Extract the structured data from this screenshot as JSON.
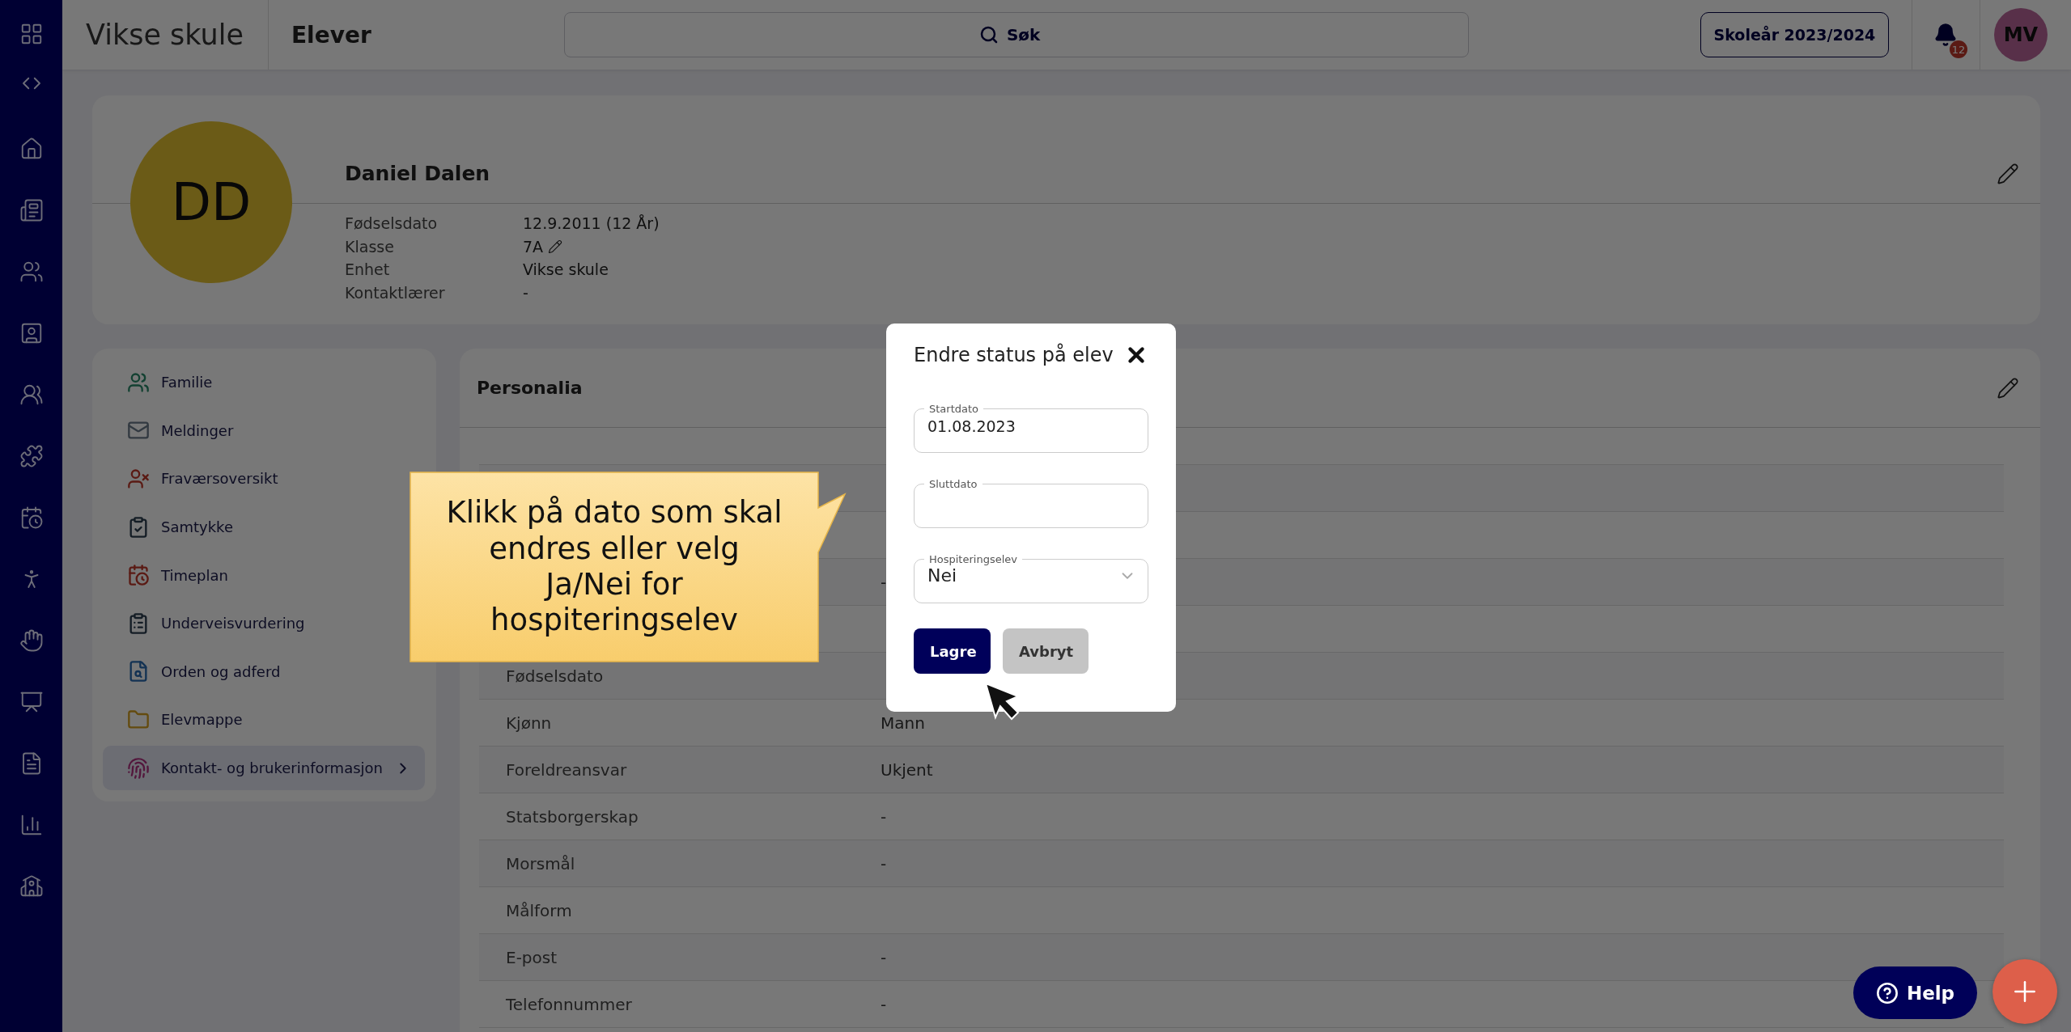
{
  "app_bar": {
    "school": "Vikse skule",
    "section": "Elever",
    "search": {
      "placeholder": "Søk"
    },
    "school_year": "Skoleår 2023/2024",
    "notification_count": "12",
    "user_initials": "MV"
  },
  "profile": {
    "initials": "DD",
    "name": "Daniel Dalen",
    "details": [
      {
        "label": "Fødselsdato",
        "value": "12.9.2011 (12 År)",
        "editable": false
      },
      {
        "label": "Klasse",
        "value": "7A",
        "editable": true
      },
      {
        "label": "Enhet",
        "value": "Vikse skule",
        "editable": false
      },
      {
        "label": "Kontaktlærer",
        "value": "-",
        "editable": false
      }
    ]
  },
  "side_menu": [
    {
      "label": "Familie",
      "selected": false
    },
    {
      "label": "Meldinger",
      "selected": false
    },
    {
      "label": "Fraværsoversikt",
      "selected": false
    },
    {
      "label": "Samtykke",
      "selected": false
    },
    {
      "label": "Timeplan",
      "selected": false
    },
    {
      "label": "Underveisvurdering",
      "selected": false
    },
    {
      "label": "Orden og adferd",
      "selected": false
    },
    {
      "label": "Elevmappe",
      "selected": false
    },
    {
      "label": "Kontakt- og brukerinformasjon",
      "selected": true
    }
  ],
  "personalia": {
    "title": "Personalia",
    "rows": [
      {},
      {},
      {
        "value": "-"
      },
      {},
      {
        "label": "Fødselsdato"
      },
      {
        "label": "Kjønn",
        "value": "Mann"
      },
      {
        "label": "Foreldreansvar",
        "value": "Ukjent"
      },
      {
        "label": "Statsborgerskap",
        "value": "-"
      },
      {
        "label": "Morsmål",
        "value": "-"
      },
      {
        "label": "Målform"
      },
      {
        "label": "E-post",
        "value": "-"
      },
      {
        "label": "Telefonnummer",
        "value": "-"
      }
    ]
  },
  "dialog": {
    "title": "Endre status på elev",
    "fields": [
      {
        "kind": "text",
        "label": "Startdato",
        "value": "01.08.2023"
      },
      {
        "kind": "text",
        "label": "Sluttdato"
      },
      {
        "kind": "select",
        "label": "Hospiteringselev",
        "value": "Nei"
      }
    ],
    "buttons": [
      {
        "kind": "primary",
        "label": "Lagre"
      },
      {
        "kind": "secondary",
        "label": "Avbryt"
      }
    ]
  },
  "callout": {
    "text": "Klikk på dato som skal\nendres eller velg\nJa/Nei for\nhospiteringselev"
  },
  "help_button": {
    "label": "Help"
  }
}
